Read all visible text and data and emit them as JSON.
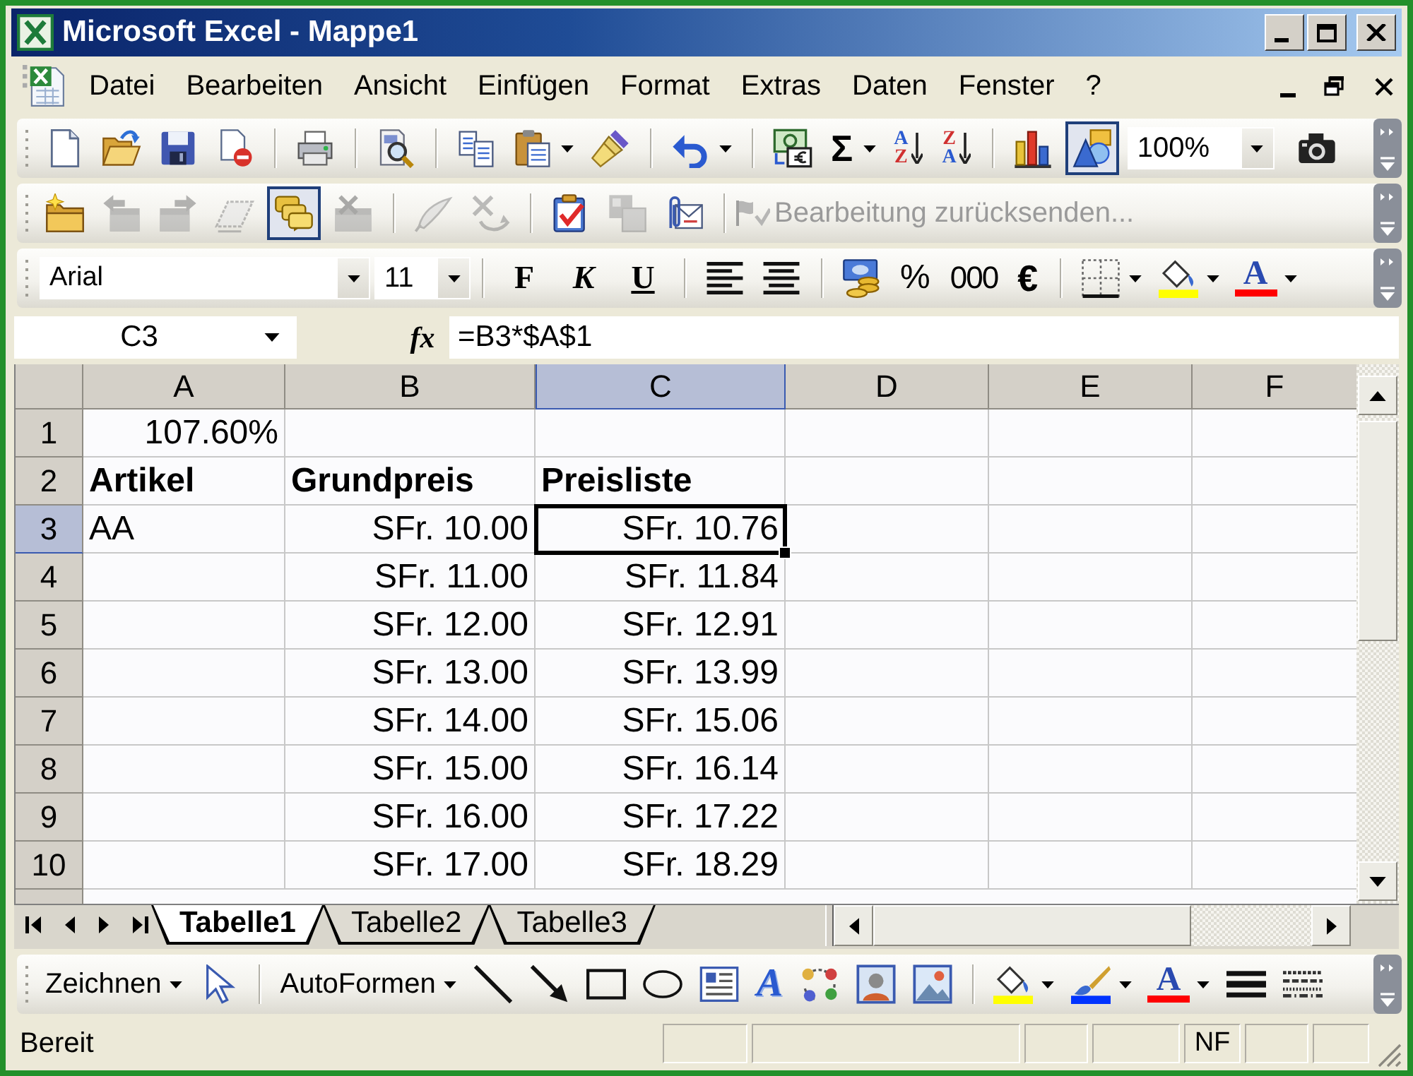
{
  "window": {
    "title": "Microsoft Excel - Mappe1"
  },
  "menu_bar": {
    "items": [
      "Datei",
      "Bearbeiten",
      "Ansicht",
      "Einfügen",
      "Format",
      "Extras",
      "Daten",
      "Fenster",
      "?"
    ]
  },
  "standard_toolbar": {
    "autosum": "Σ",
    "sort_ascending": [
      "A",
      "Z"
    ],
    "sort_descending": [
      "Z",
      "A"
    ],
    "drawing": {
      "pressed": true
    },
    "zoom": "100%"
  },
  "reviewing_toolbar": {
    "new_comment": {
      "disabled": false
    },
    "previous_comment": {
      "disabled": true
    },
    "next_comment": {
      "disabled": true
    },
    "show_comment": {
      "disabled": true
    },
    "show_all_comments": {
      "disabled": false,
      "pressed": true
    },
    "delete_comment": {
      "disabled": true
    },
    "ink_annotations": {
      "disabled": true
    },
    "delete_ink": {
      "disabled": true
    },
    "track_changes": {
      "disabled": false
    },
    "update_file": {
      "disabled": true
    },
    "send_to_mail": {
      "disabled": false
    },
    "reply_with_changes": {
      "label": "Bearbeitung zurücksenden...",
      "disabled": true
    }
  },
  "formatting_toolbar": {
    "font": "Arial",
    "size": "11",
    "bold": "F",
    "italic": "K",
    "underline": "U",
    "percent": "%",
    "thousands": "000",
    "euro": "€",
    "font_color": "A"
  },
  "formula_bar": {
    "name_box": "C3",
    "function_label": "fx",
    "formula": "=B3*$A$1"
  },
  "sheet": {
    "columns": [
      {
        "label": "A",
        "selected": false
      },
      {
        "label": "B",
        "selected": false
      },
      {
        "label": "C",
        "selected": true
      },
      {
        "label": "D",
        "selected": false
      },
      {
        "label": "E",
        "selected": false
      },
      {
        "label": "F",
        "selected": false
      }
    ],
    "rows": [
      {
        "label": "1",
        "selected": false,
        "cells": [
          {
            "kind": "number",
            "value": "107.60%",
            "selected": false
          },
          {
            "kind": "empty",
            "selected": false
          },
          {
            "kind": "empty",
            "selected": false
          },
          {
            "kind": "empty",
            "selected": false
          },
          {
            "kind": "empty",
            "selected": false
          },
          {
            "kind": "empty",
            "selected": false
          }
        ]
      },
      {
        "label": "2",
        "selected": false,
        "cells": [
          {
            "kind": "heading",
            "value": "Artikel",
            "selected": false
          },
          {
            "kind": "heading",
            "value": "Grundpreis",
            "selected": false
          },
          {
            "kind": "heading",
            "value": "Preisliste",
            "selected": false
          },
          {
            "kind": "empty",
            "selected": false
          },
          {
            "kind": "empty",
            "selected": false
          },
          {
            "kind": "empty",
            "selected": false
          }
        ]
      },
      {
        "label": "3",
        "selected": true,
        "cells": [
          {
            "kind": "text",
            "value": "AA",
            "selected": false
          },
          {
            "kind": "number",
            "value": "SFr. 10.00",
            "selected": false
          },
          {
            "kind": "number",
            "value": "SFr. 10.76",
            "selected": true
          },
          {
            "kind": "empty",
            "selected": false
          },
          {
            "kind": "empty",
            "selected": false
          },
          {
            "kind": "empty",
            "selected": false
          }
        ]
      },
      {
        "label": "4",
        "selected": false,
        "cells": [
          {
            "kind": "empty",
            "selected": false
          },
          {
            "kind": "number",
            "value": "SFr. 11.00",
            "selected": false
          },
          {
            "kind": "number",
            "value": "SFr. 11.84",
            "selected": false
          },
          {
            "kind": "empty",
            "selected": false
          },
          {
            "kind": "empty",
            "selected": false
          },
          {
            "kind": "empty",
            "selected": false
          }
        ]
      },
      {
        "label": "5",
        "selected": false,
        "cells": [
          {
            "kind": "empty",
            "selected": false
          },
          {
            "kind": "number",
            "value": "SFr. 12.00",
            "selected": false
          },
          {
            "kind": "number",
            "value": "SFr. 12.91",
            "selected": false
          },
          {
            "kind": "empty",
            "selected": false
          },
          {
            "kind": "empty",
            "selected": false
          },
          {
            "kind": "empty",
            "selected": false
          }
        ]
      },
      {
        "label": "6",
        "selected": false,
        "cells": [
          {
            "kind": "empty",
            "selected": false
          },
          {
            "kind": "number",
            "value": "SFr. 13.00",
            "selected": false
          },
          {
            "kind": "number",
            "value": "SFr. 13.99",
            "selected": false
          },
          {
            "kind": "empty",
            "selected": false
          },
          {
            "kind": "empty",
            "selected": false
          },
          {
            "kind": "empty",
            "selected": false
          }
        ]
      },
      {
        "label": "7",
        "selected": false,
        "cells": [
          {
            "kind": "empty",
            "selected": false
          },
          {
            "kind": "number",
            "value": "SFr. 14.00",
            "selected": false
          },
          {
            "kind": "number",
            "value": "SFr. 15.06",
            "selected": false
          },
          {
            "kind": "empty",
            "selected": false
          },
          {
            "kind": "empty",
            "selected": false
          },
          {
            "kind": "empty",
            "selected": false
          }
        ]
      },
      {
        "label": "8",
        "selected": false,
        "cells": [
          {
            "kind": "empty",
            "selected": false
          },
          {
            "kind": "number",
            "value": "SFr. 15.00",
            "selected": false
          },
          {
            "kind": "number",
            "value": "SFr. 16.14",
            "selected": false
          },
          {
            "kind": "empty",
            "selected": false
          },
          {
            "kind": "empty",
            "selected": false
          },
          {
            "kind": "empty",
            "selected": false
          }
        ]
      },
      {
        "label": "9",
        "selected": false,
        "cells": [
          {
            "kind": "empty",
            "selected": false
          },
          {
            "kind": "number",
            "value": "SFr. 16.00",
            "selected": false
          },
          {
            "kind": "number",
            "value": "SFr. 17.22",
            "selected": false
          },
          {
            "kind": "empty",
            "selected": false
          },
          {
            "kind": "empty",
            "selected": false
          },
          {
            "kind": "empty",
            "selected": false
          }
        ]
      },
      {
        "label": "10",
        "selected": false,
        "cells": [
          {
            "kind": "empty",
            "selected": false
          },
          {
            "kind": "number",
            "value": "SFr. 17.00",
            "selected": false
          },
          {
            "kind": "number",
            "value": "SFr. 18.29",
            "selected": false
          },
          {
            "kind": "empty",
            "selected": false
          },
          {
            "kind": "empty",
            "selected": false
          },
          {
            "kind": "empty",
            "selected": false
          }
        ]
      }
    ]
  },
  "sheet_tabs": [
    {
      "label": "Tabelle1",
      "selected": true
    },
    {
      "label": "Tabelle2",
      "selected": false
    },
    {
      "label": "Tabelle3",
      "selected": false
    }
  ],
  "drawing_toolbar": {
    "draw_menu": "Zeichnen",
    "autoshapes_menu": "AutoFormen",
    "wordart": "A",
    "font_color": "A"
  },
  "status_bar": {
    "message": "Bereit",
    "indicator": "NF"
  }
}
